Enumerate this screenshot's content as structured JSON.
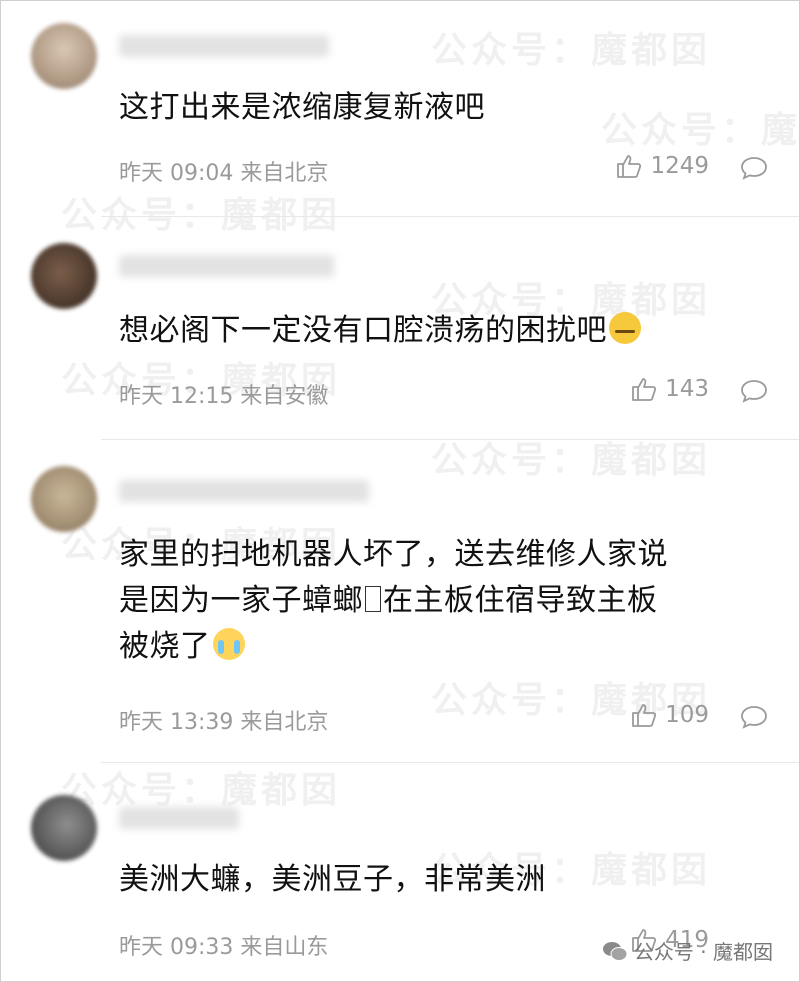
{
  "comments": [
    {
      "text": "这打出来是浓缩康复新液吧",
      "time_location": "昨天 09:04 来自北京",
      "likes": "1249"
    },
    {
      "text": "想必阁下一定没有口腔溃疡的困扰吧",
      "emoji": "zipper-mouth-emoji",
      "time_location": "昨天 12:15 来自安徽",
      "likes": "143"
    },
    {
      "text_line1": "家里的扫地机器人坏了，送去维修人家说",
      "text_line2a": "是因为一家子蟑螂",
      "text_line2b": "在主板住宿导致主板",
      "text_line3": "被烧了",
      "emoji": "crying-face-emoji",
      "time_location": "昨天 13:39 来自北京",
      "likes": "109"
    },
    {
      "text": "美洲大蠊，美洲豆子，非常美洲",
      "time_location": "昨天 09:33 来自山东",
      "likes": "419"
    }
  ],
  "watermark": "公众号：魔都囡",
  "footer": {
    "label": "公众号 · 魔都囡"
  },
  "colors": {
    "text": "#111111",
    "meta": "#9a9a9a"
  }
}
